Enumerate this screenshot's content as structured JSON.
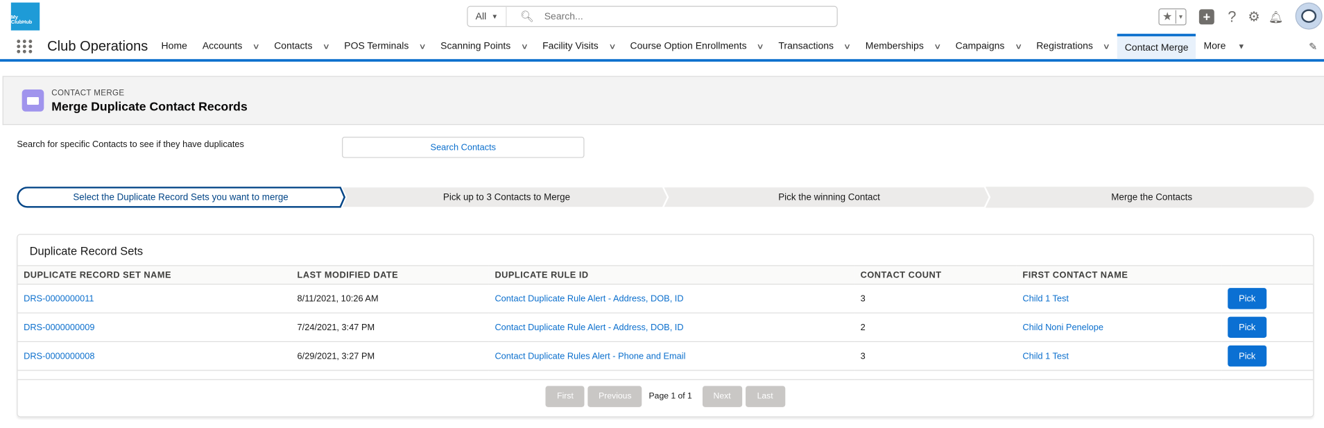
{
  "brand": {
    "logo_text": "My ClubHub",
    "logo_color": "#1e9bd7"
  },
  "search": {
    "scope": "All",
    "placeholder": "Search..."
  },
  "header_icons": [
    "favorites-icon",
    "add-icon",
    "help-icon",
    "setup-gear-icon",
    "notifications-bell-icon",
    "user-avatar"
  ],
  "nav": {
    "app_name": "Club Operations",
    "tabs": [
      {
        "label": "Home",
        "menu": false
      },
      {
        "label": "Accounts",
        "menu": true
      },
      {
        "label": "Contacts",
        "menu": true
      },
      {
        "label": "POS Terminals",
        "menu": true
      },
      {
        "label": "Scanning Points",
        "menu": true
      },
      {
        "label": "Facility Visits",
        "menu": true
      },
      {
        "label": "Course Option Enrollments",
        "menu": true
      },
      {
        "label": "Transactions",
        "menu": true
      },
      {
        "label": "Memberships",
        "menu": true
      },
      {
        "label": "Campaigns",
        "menu": true
      },
      {
        "label": "Registrations",
        "menu": true
      },
      {
        "label": "Contact Merge",
        "menu": false,
        "active": true
      },
      {
        "label": "More",
        "menu": true
      }
    ],
    "accent": "#0b6fcd"
  },
  "page_header": {
    "object_type": "CONTACT MERGE",
    "title": "Merge Duplicate Contact Records",
    "icon_color": "#a094ed"
  },
  "search_section": {
    "hint": "Search for specific Contacts to see if they have duplicates",
    "button": "Search Contacts"
  },
  "path": {
    "steps": [
      "Select the Duplicate Record Sets you want to merge",
      "Pick up to 3 Contacts to Merge",
      "Pick the winning Contact",
      "Merge the Contacts"
    ],
    "current_step": 1
  },
  "card": {
    "title": "Duplicate Record Sets",
    "columns": [
      "DUPLICATE RECORD SET NAME",
      "LAST MODIFIED DATE",
      "DUPLICATE RULE ID",
      "CONTACT COUNT",
      "FIRST CONTACT NAME"
    ],
    "rows": [
      {
        "name": "DRS-0000000011",
        "modified": "8/11/2021, 10:26 AM",
        "rule": "Contact Duplicate Rule Alert - Address, DOB, ID",
        "count": "3",
        "first_contact": "Child 1 Test",
        "action": "Pick"
      },
      {
        "name": "DRS-0000000009",
        "modified": "7/24/2021, 3:47 PM",
        "rule": "Contact Duplicate Rule Alert - Address, DOB, ID",
        "count": "2",
        "first_contact": "Child Noni Penelope",
        "action": "Pick"
      },
      {
        "name": "DRS-0000000008",
        "modified": "6/29/2021, 3:27 PM",
        "rule": "Contact Duplicate Rules Alert - Phone and Email",
        "count": "3",
        "first_contact": "Child 1 Test",
        "action": "Pick"
      }
    ],
    "pager": {
      "first": "First",
      "previous": "Previous",
      "page_text": "Page 1 of 1",
      "next": "Next",
      "last": "Last"
    }
  }
}
